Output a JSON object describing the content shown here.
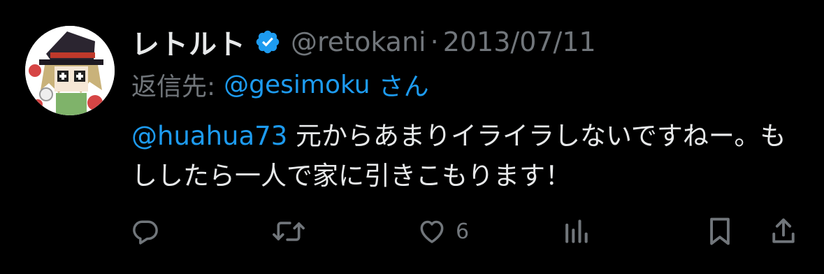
{
  "tweet": {
    "display_name": "レトルト",
    "handle": "@retokani",
    "separator": "·",
    "date": "2013/07/11",
    "reply_label": "返信先:",
    "reply_handle": "@gesimoku",
    "reply_suffix": "さん",
    "mention": "@huahua73",
    "text": " 元からあまりイライラしないですねー。もししたら一人で家に引きこもります！",
    "like_count": "6"
  },
  "colors": {
    "background": "#000000",
    "primary_text": "#e7e9ea",
    "secondary_text": "#71767b",
    "accent_blue": "#1d9bf0"
  },
  "icons": {
    "verified": "verified-badge-icon",
    "reply": "reply-icon",
    "retweet": "retweet-icon",
    "like": "heart-icon",
    "views": "views-icon",
    "bookmark": "bookmark-icon",
    "share": "share-icon"
  }
}
